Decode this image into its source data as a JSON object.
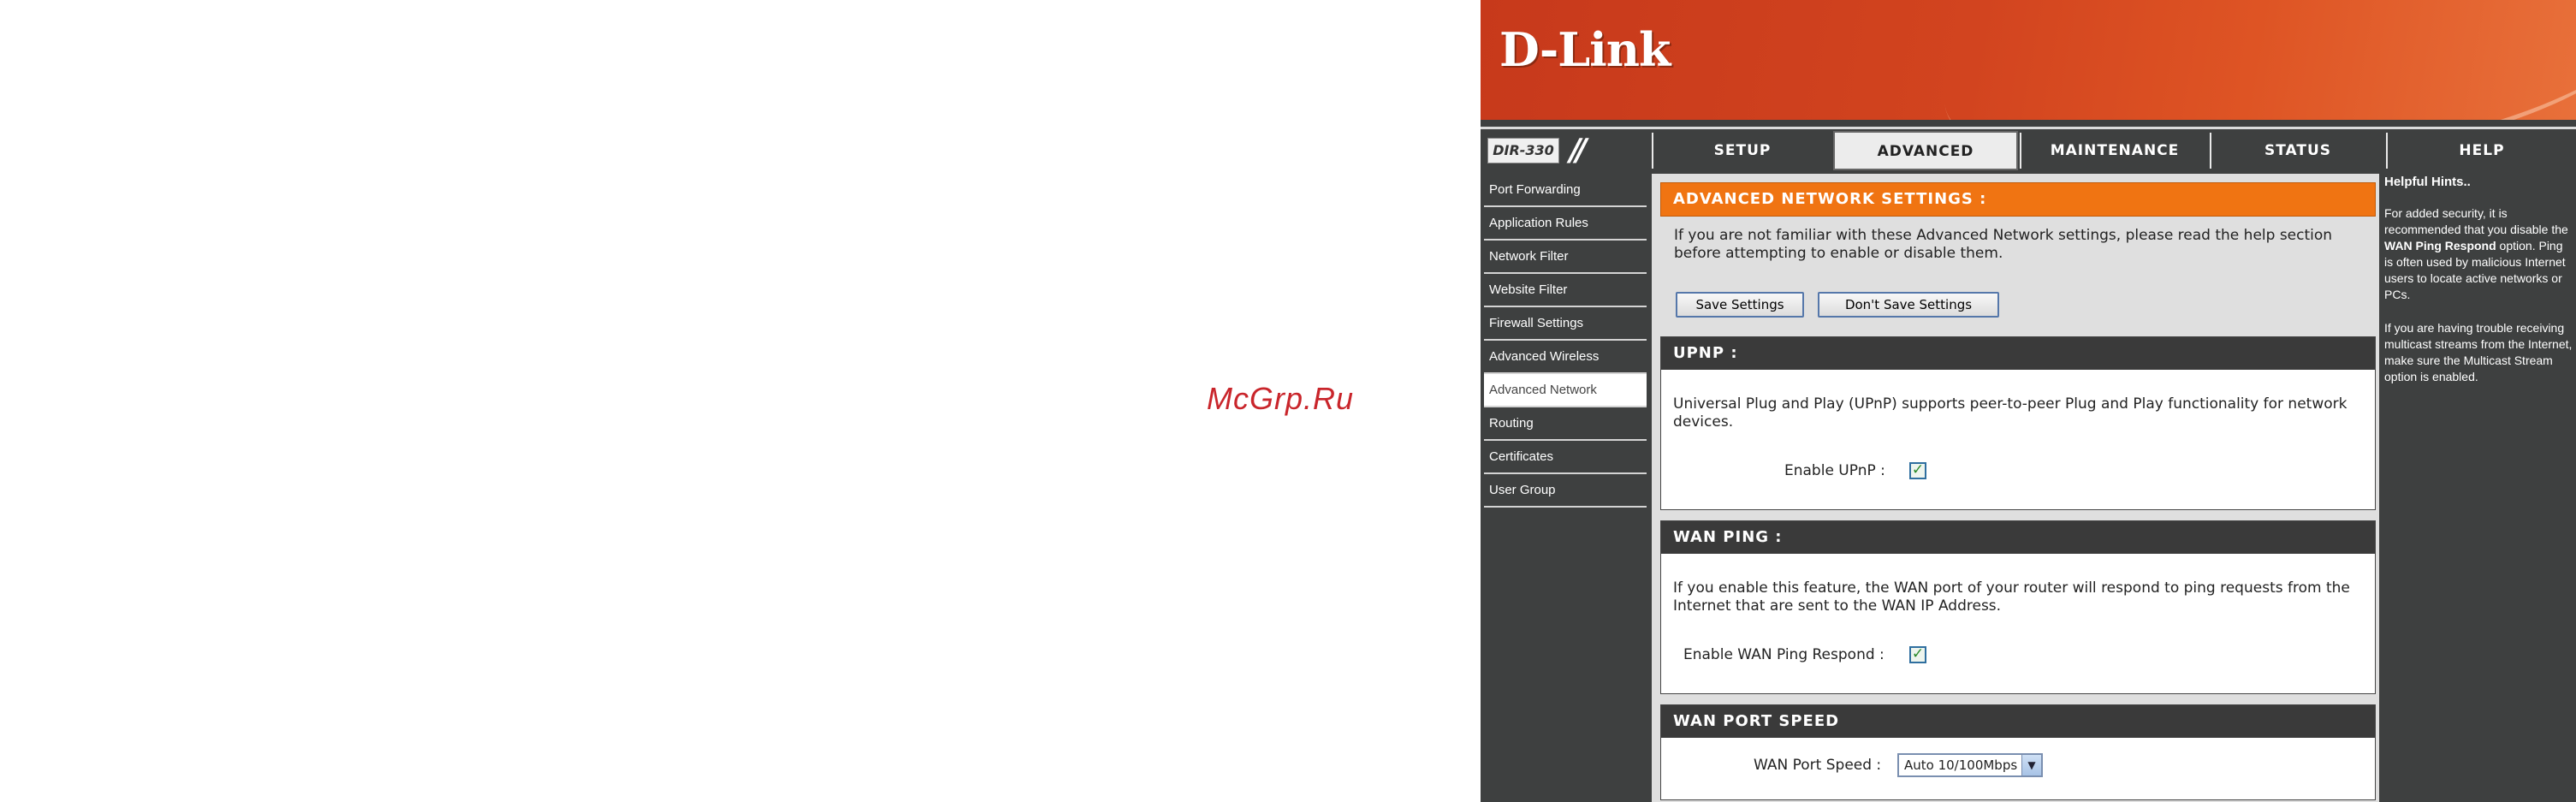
{
  "watermark": "McGrp.Ru",
  "brand": {
    "logo": "D-Link",
    "model": "DIR-330",
    "accent": "#f07412",
    "banner": "#d2441f"
  },
  "nav": {
    "tabs": [
      {
        "label": "SETUP"
      },
      {
        "label": "ADVANCED"
      },
      {
        "label": "MAINTENANCE"
      },
      {
        "label": "STATUS"
      },
      {
        "label": "HELP"
      }
    ],
    "active": "ADVANCED"
  },
  "sidebar": {
    "items": [
      {
        "label": "Port Forwarding"
      },
      {
        "label": "Application Rules"
      },
      {
        "label": "Network Filter"
      },
      {
        "label": "Website Filter"
      },
      {
        "label": "Firewall Settings"
      },
      {
        "label": "Advanced Wireless"
      },
      {
        "label": "Advanced Network"
      },
      {
        "label": "Routing"
      },
      {
        "label": "Certificates"
      },
      {
        "label": "User Group"
      }
    ],
    "active": "Advanced Network"
  },
  "advanced": {
    "title": "ADVANCED NETWORK SETTINGS :",
    "description": "If you are not familiar with these Advanced Network settings, please read the help section before attempting to enable or disable them.",
    "save_label": "Save Settings",
    "dont_save_label": "Don't Save Settings"
  },
  "upnp": {
    "title": "UPNP :",
    "description": "Universal Plug and Play (UPnP) supports peer-to-peer Plug and Play functionality for network devices.",
    "enable_label": "Enable UPnP :",
    "enabled": true
  },
  "wan_ping": {
    "title": "WAN PING :",
    "description": "If you enable this feature, the WAN port of your router will respond to ping requests from the Internet that are sent to the WAN IP Address.",
    "enable_label": "Enable WAN Ping Respond :",
    "enabled": true
  },
  "wan_speed": {
    "title": "WAN PORT SPEED",
    "label": "WAN Port Speed :",
    "value": "Auto 10/100Mbps"
  },
  "hints": {
    "title": "Helpful Hints..",
    "p1_before": "For added security, it is recommended that you disable the ",
    "p1_bold": "WAN Ping Respond",
    "p1_after": " option. Ping is often used by malicious Internet users to locate active networks or PCs.",
    "p2": "If you are having trouble receiving multicast streams from the Internet, make sure the Multicast Stream option is enabled."
  },
  "check_glyph": "✓"
}
